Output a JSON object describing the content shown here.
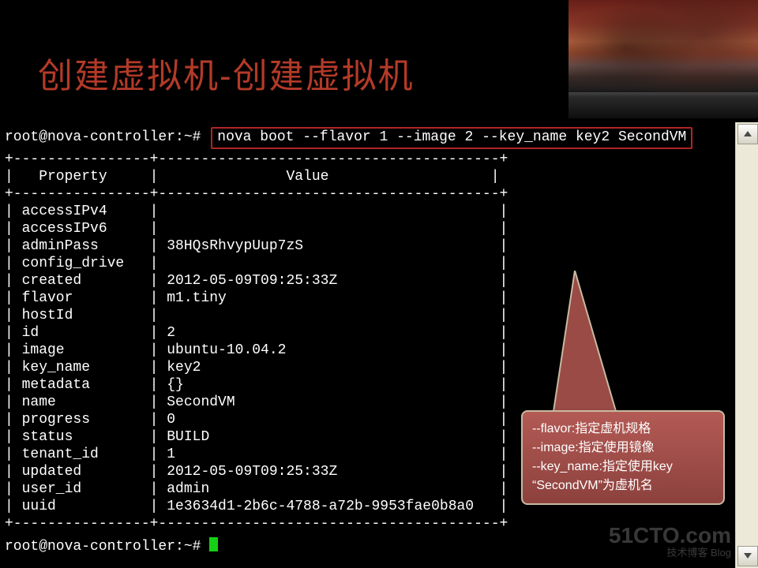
{
  "title": "创建虚拟机-创建虚拟机",
  "prompt": "root@nova-controller:~#",
  "command": "nova boot --flavor 1 --image 2 --key_name key2 SecondVM",
  "table": {
    "header_left": "Property",
    "header_right": "Value",
    "rows": [
      {
        "k": "accessIPv4",
        "v": ""
      },
      {
        "k": "accessIPv6",
        "v": ""
      },
      {
        "k": "adminPass",
        "v": "38HQsRhvypUup7zS"
      },
      {
        "k": "config_drive",
        "v": ""
      },
      {
        "k": "created",
        "v": "2012-05-09T09:25:33Z"
      },
      {
        "k": "flavor",
        "v": "m1.tiny"
      },
      {
        "k": "hostId",
        "v": ""
      },
      {
        "k": "id",
        "v": "2"
      },
      {
        "k": "image",
        "v": "ubuntu-10.04.2"
      },
      {
        "k": "key_name",
        "v": "key2"
      },
      {
        "k": "metadata",
        "v": "{}"
      },
      {
        "k": "name",
        "v": "SecondVM"
      },
      {
        "k": "progress",
        "v": "0"
      },
      {
        "k": "status",
        "v": "BUILD"
      },
      {
        "k": "tenant_id",
        "v": "1"
      },
      {
        "k": "updated",
        "v": "2012-05-09T09:25:33Z"
      },
      {
        "k": "user_id",
        "v": "admin"
      },
      {
        "k": "uuid",
        "v": "1e3634d1-2b6c-4788-a72b-9953fae0b8a0"
      }
    ]
  },
  "callout": {
    "l1": "--flavor:指定虚机规格",
    "l2": "--image:指定使用镜像",
    "l3": "--key_name:指定使用key",
    "l4": "“SecondVM”为虚机名"
  },
  "prompt2": "root@nova-controller:~#",
  "watermark": {
    "brand": "51CTO.com",
    "sub": "技术博客  Blog"
  }
}
